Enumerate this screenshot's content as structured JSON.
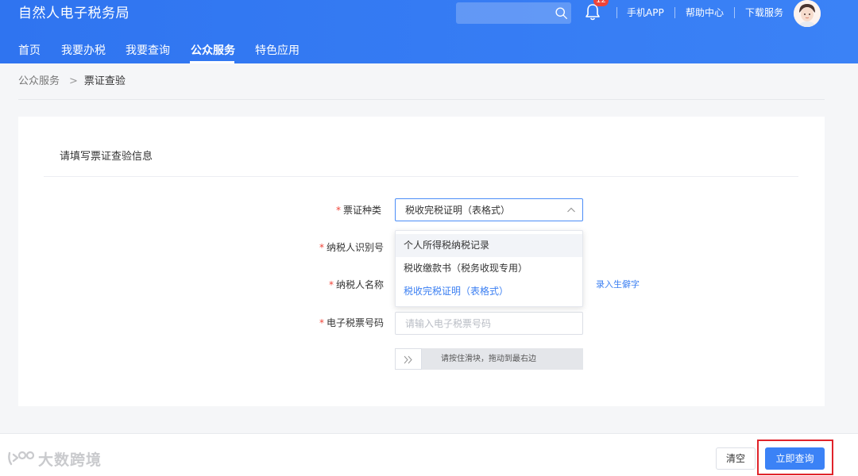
{
  "header": {
    "title": "自然人电子税务局",
    "search_placeholder": "",
    "notification_count": "12",
    "links": [
      "手机APP",
      "帮助中心",
      "下载服务"
    ]
  },
  "nav": {
    "items": [
      "首页",
      "我要办税",
      "我要查询",
      "公众服务",
      "特色应用"
    ],
    "active": "公众服务"
  },
  "breadcrumb": {
    "parent": "公众服务",
    "separator": ">",
    "current": "票证查验"
  },
  "form": {
    "title": "请填写票证查验信息",
    "required_mark": "*",
    "fields": {
      "cert_type": {
        "label": "票证种类",
        "value": "税收完税证明（表格式）"
      },
      "taxpayer_id": {
        "label": "纳税人识别号"
      },
      "taxpayer_name": {
        "label": "纳税人名称",
        "rare_char_link": "录入生僻字"
      },
      "ebill_number": {
        "label": "电子税票号码",
        "placeholder": "请输入电子税票号码"
      }
    },
    "dropdown_options": [
      "个人所得税纳税记录",
      "税收缴款书（税务收现专用）",
      "税收完税证明（表格式）"
    ],
    "dropdown_selected_index": 2,
    "slider": {
      "handle_glyph": "»",
      "text": "请按住滑块，拖动到最右边"
    }
  },
  "footer": {
    "clear_label": "清空",
    "query_label": "立即查询",
    "watermark": "大数跨境"
  },
  "colors": {
    "brand_blue": "#3b82f6",
    "link_blue": "#3b7ff2",
    "required_red": "#f04438",
    "highlight_red": "#e0242b"
  }
}
